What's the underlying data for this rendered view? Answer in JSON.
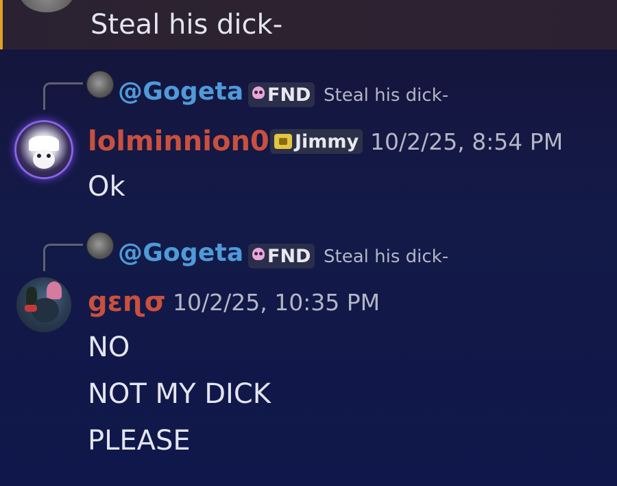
{
  "top_message": {
    "text": "Steal his dick-"
  },
  "messages": [
    {
      "reply": {
        "mention": "@Gogeta",
        "tag": "FND",
        "text": "Steal his dick-"
      },
      "author": "lolminnion0",
      "role_tag": "Jimmy",
      "timestamp": "10/2/25, 8:54 PM",
      "lines": [
        "Ok"
      ]
    },
    {
      "reply": {
        "mention": "@Gogeta",
        "tag": "FND",
        "text": "Steal his dick-"
      },
      "author": "gɛɳσ",
      "timestamp": "10/2/25, 10:35 PM",
      "lines": [
        "NO",
        "NOT MY DICK",
        "PLEASE"
      ]
    }
  ],
  "colors": {
    "accent_bar": "#e0a224",
    "mention": "#4f9ad8",
    "username": "#c9503e",
    "background": "#131a48"
  },
  "icons": {
    "fnd_tag_icon": "skull-icon",
    "jimmy_tag_icon": "crown-icon"
  }
}
